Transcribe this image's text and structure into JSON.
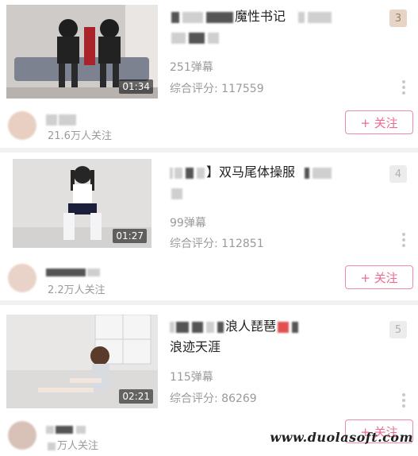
{
  "videos": [
    {
      "title_text": "魔性书记",
      "duration": "01:34",
      "danmaku": "251弹幕",
      "score": "综合评分: 117559",
      "rank": "3",
      "followers": "21.6万人关注",
      "follow_label": "+ 关注"
    },
    {
      "title_text": "】双马尾体操服",
      "duration": "01:27",
      "danmaku": "99弹幕",
      "score": "综合评分: 112851",
      "rank": "4",
      "followers": "2.2万人关注",
      "follow_label": "+ 关注"
    },
    {
      "title_text": "浪人琵琶",
      "title_line2": "浪迹天涯",
      "duration": "02:21",
      "danmaku": "115弹幕",
      "score": "综合评分: 86269",
      "rank": "5",
      "followers": "万人关注",
      "follow_label": "+ 关注"
    }
  ],
  "watermark": "www.duolasoft.com",
  "colors": {
    "accent": "#ec6b8d",
    "rank_top": "#e6d5c6",
    "divider": "#f1f1f1"
  }
}
